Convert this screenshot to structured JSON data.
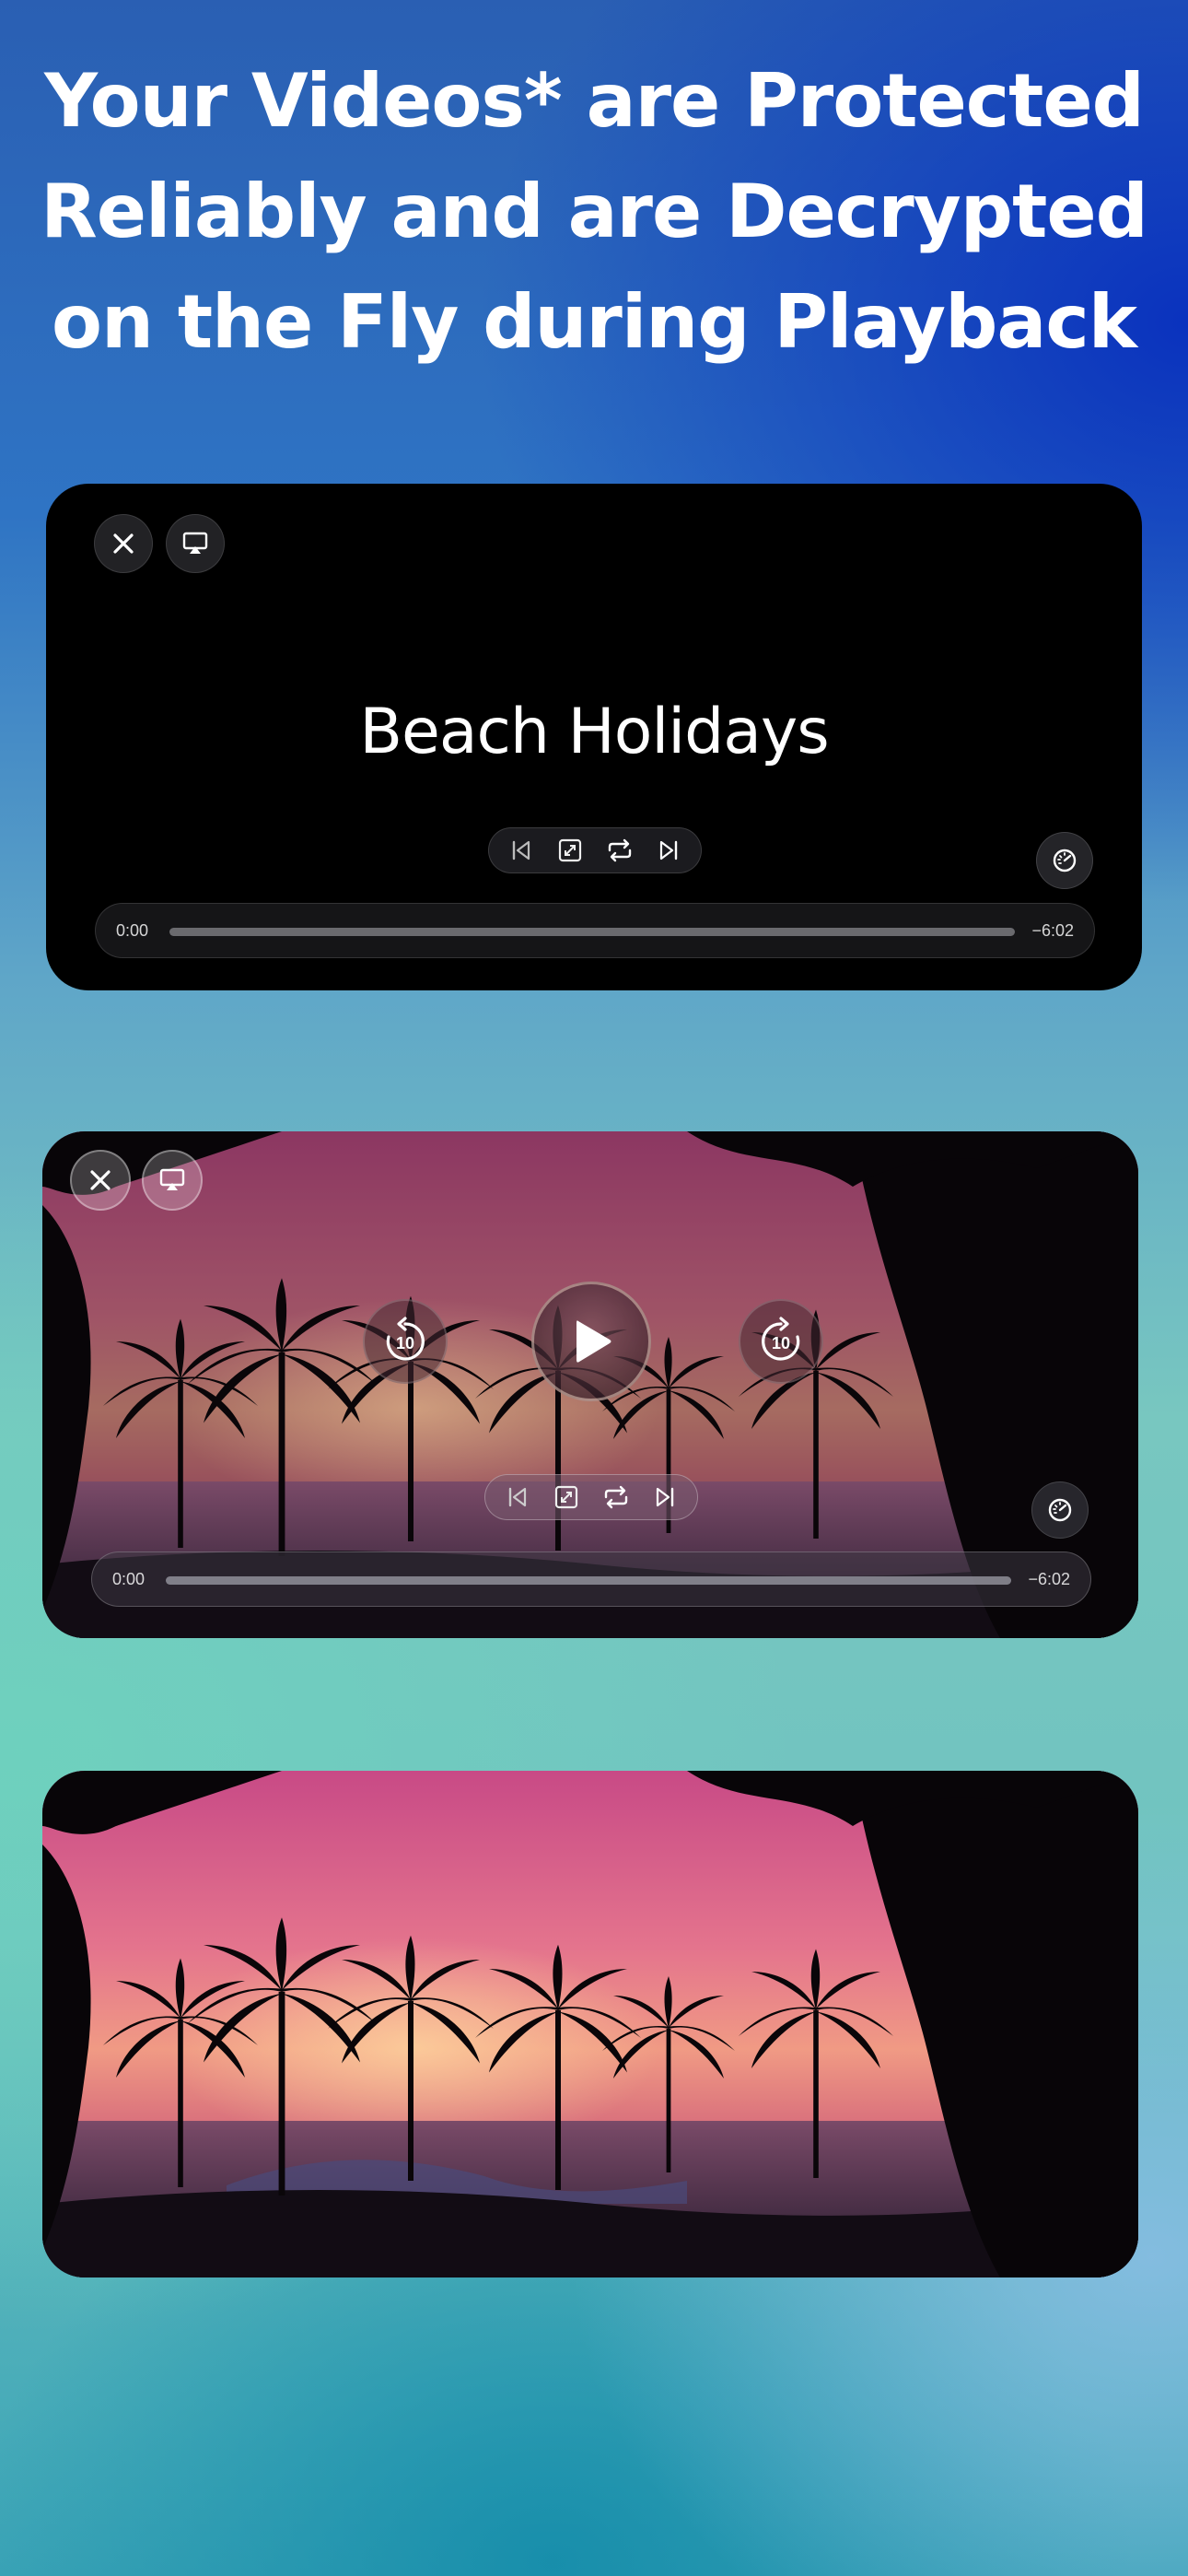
{
  "headline": {
    "line1": "Your Videos* are Protected",
    "line2": "Reliably and are Decrypted",
    "line3": "on the Fly during Playback"
  },
  "players": [
    {
      "state": "loading",
      "title": "Beach Holidays",
      "time_elapsed": "0:00",
      "time_remaining": "−6:02",
      "progress": 0
    },
    {
      "state": "paused-with-controls",
      "time_elapsed": "0:00",
      "time_remaining": "−6:02",
      "progress": 0,
      "skip_back_label": "10",
      "skip_forward_label": "10"
    },
    {
      "state": "playing-controls-hidden"
    }
  ],
  "icons": {
    "close": "close-icon",
    "airplay": "airplay-icon",
    "previous": "skip-previous-icon",
    "expand": "expand-icon",
    "repeat": "repeat-icon",
    "next": "skip-next-icon",
    "speed": "speedometer-icon",
    "play": "play-icon",
    "rewind": "rewind-10-icon",
    "forward": "forward-10-icon"
  },
  "colors": {
    "player_bg": "#000000",
    "text": "#ffffff",
    "track": "#6a6a6e"
  }
}
